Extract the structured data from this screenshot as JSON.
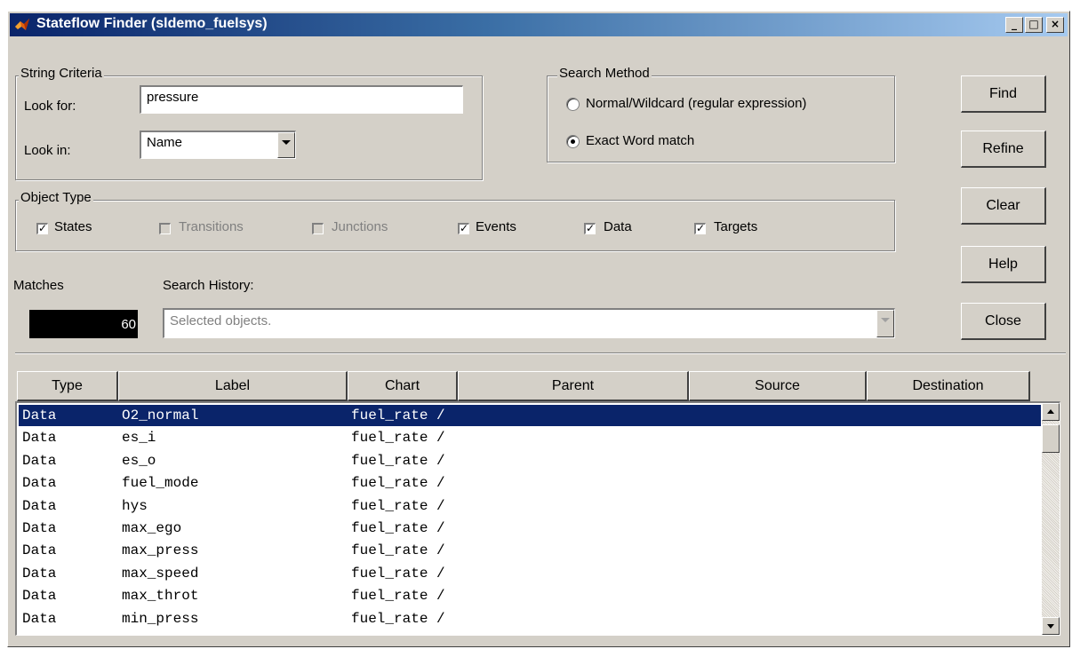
{
  "window": {
    "title": "Stateflow Finder (sldemo_fuelsys)",
    "controls": {
      "minimize": "_",
      "maximize": "□",
      "close": "×"
    }
  },
  "string_criteria": {
    "legend": "String Criteria",
    "look_for_label": "Look for:",
    "look_for_value": "pressure",
    "look_in_label": "Look in:",
    "look_in_value": "Name"
  },
  "search_method": {
    "legend": "Search Method",
    "options": [
      {
        "label": "Normal/Wildcard (regular expression)",
        "selected": false
      },
      {
        "label": "Exact Word match",
        "selected": true
      }
    ]
  },
  "object_type": {
    "legend": "Object Type",
    "items": [
      {
        "label": "States",
        "checked": true,
        "enabled": true
      },
      {
        "label": "Transitions",
        "checked": false,
        "enabled": false
      },
      {
        "label": "Junctions",
        "checked": false,
        "enabled": false
      },
      {
        "label": "Events",
        "checked": true,
        "enabled": true
      },
      {
        "label": "Data",
        "checked": true,
        "enabled": true
      },
      {
        "label": "Targets",
        "checked": true,
        "enabled": true
      }
    ]
  },
  "matches": {
    "label": "Matches",
    "value": "60"
  },
  "search_history": {
    "label": "Search History:",
    "value": "Selected objects."
  },
  "buttons": {
    "find": "Find",
    "refine": "Refine",
    "clear": "Clear",
    "help": "Help",
    "close": "Close"
  },
  "table": {
    "columns": [
      "Type",
      "Label",
      "Chart",
      "Parent",
      "Source",
      "Destination"
    ],
    "rows": [
      {
        "type": "Data",
        "label": "O2_normal",
        "chart": "fuel_rate /",
        "selected": true
      },
      {
        "type": "Data",
        "label": "es_i",
        "chart": "fuel_rate /"
      },
      {
        "type": "Data",
        "label": "es_o",
        "chart": "fuel_rate /"
      },
      {
        "type": "Data",
        "label": "fuel_mode",
        "chart": "fuel_rate /"
      },
      {
        "type": "Data",
        "label": "hys",
        "chart": "fuel_rate /"
      },
      {
        "type": "Data",
        "label": "max_ego",
        "chart": "fuel_rate /"
      },
      {
        "type": "Data",
        "label": "max_press",
        "chart": "fuel_rate /"
      },
      {
        "type": "Data",
        "label": "max_speed",
        "chart": "fuel_rate /"
      },
      {
        "type": "Data",
        "label": "max_throt",
        "chart": "fuel_rate /"
      },
      {
        "type": "Data",
        "label": "min_press",
        "chart": "fuel_rate /"
      }
    ]
  }
}
